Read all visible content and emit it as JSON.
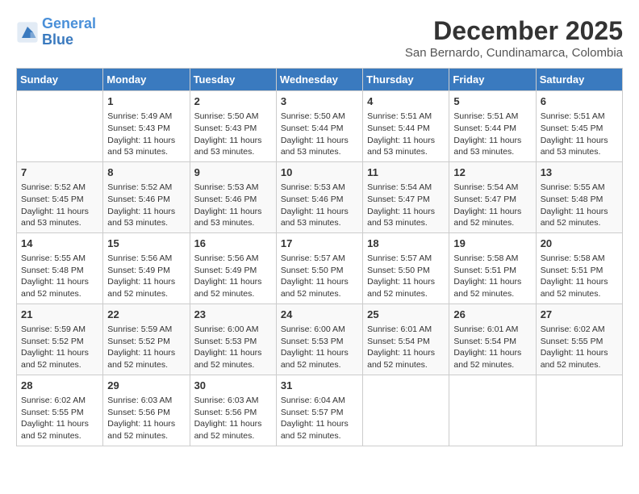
{
  "header": {
    "logo_line1": "General",
    "logo_line2": "Blue",
    "title": "December 2025",
    "subtitle": "San Bernardo, Cundinamarca, Colombia"
  },
  "days_of_week": [
    "Sunday",
    "Monday",
    "Tuesday",
    "Wednesday",
    "Thursday",
    "Friday",
    "Saturday"
  ],
  "weeks": [
    [
      {
        "day": "",
        "info": ""
      },
      {
        "day": "1",
        "info": "Sunrise: 5:49 AM\nSunset: 5:43 PM\nDaylight: 11 hours\nand 53 minutes."
      },
      {
        "day": "2",
        "info": "Sunrise: 5:50 AM\nSunset: 5:43 PM\nDaylight: 11 hours\nand 53 minutes."
      },
      {
        "day": "3",
        "info": "Sunrise: 5:50 AM\nSunset: 5:44 PM\nDaylight: 11 hours\nand 53 minutes."
      },
      {
        "day": "4",
        "info": "Sunrise: 5:51 AM\nSunset: 5:44 PM\nDaylight: 11 hours\nand 53 minutes."
      },
      {
        "day": "5",
        "info": "Sunrise: 5:51 AM\nSunset: 5:44 PM\nDaylight: 11 hours\nand 53 minutes."
      },
      {
        "day": "6",
        "info": "Sunrise: 5:51 AM\nSunset: 5:45 PM\nDaylight: 11 hours\nand 53 minutes."
      }
    ],
    [
      {
        "day": "7",
        "info": "Sunrise: 5:52 AM\nSunset: 5:45 PM\nDaylight: 11 hours\nand 53 minutes."
      },
      {
        "day": "8",
        "info": "Sunrise: 5:52 AM\nSunset: 5:46 PM\nDaylight: 11 hours\nand 53 minutes."
      },
      {
        "day": "9",
        "info": "Sunrise: 5:53 AM\nSunset: 5:46 PM\nDaylight: 11 hours\nand 53 minutes."
      },
      {
        "day": "10",
        "info": "Sunrise: 5:53 AM\nSunset: 5:46 PM\nDaylight: 11 hours\nand 53 minutes."
      },
      {
        "day": "11",
        "info": "Sunrise: 5:54 AM\nSunset: 5:47 PM\nDaylight: 11 hours\nand 53 minutes."
      },
      {
        "day": "12",
        "info": "Sunrise: 5:54 AM\nSunset: 5:47 PM\nDaylight: 11 hours\nand 52 minutes."
      },
      {
        "day": "13",
        "info": "Sunrise: 5:55 AM\nSunset: 5:48 PM\nDaylight: 11 hours\nand 52 minutes."
      }
    ],
    [
      {
        "day": "14",
        "info": "Sunrise: 5:55 AM\nSunset: 5:48 PM\nDaylight: 11 hours\nand 52 minutes."
      },
      {
        "day": "15",
        "info": "Sunrise: 5:56 AM\nSunset: 5:49 PM\nDaylight: 11 hours\nand 52 minutes."
      },
      {
        "day": "16",
        "info": "Sunrise: 5:56 AM\nSunset: 5:49 PM\nDaylight: 11 hours\nand 52 minutes."
      },
      {
        "day": "17",
        "info": "Sunrise: 5:57 AM\nSunset: 5:50 PM\nDaylight: 11 hours\nand 52 minutes."
      },
      {
        "day": "18",
        "info": "Sunrise: 5:57 AM\nSunset: 5:50 PM\nDaylight: 11 hours\nand 52 minutes."
      },
      {
        "day": "19",
        "info": "Sunrise: 5:58 AM\nSunset: 5:51 PM\nDaylight: 11 hours\nand 52 minutes."
      },
      {
        "day": "20",
        "info": "Sunrise: 5:58 AM\nSunset: 5:51 PM\nDaylight: 11 hours\nand 52 minutes."
      }
    ],
    [
      {
        "day": "21",
        "info": "Sunrise: 5:59 AM\nSunset: 5:52 PM\nDaylight: 11 hours\nand 52 minutes."
      },
      {
        "day": "22",
        "info": "Sunrise: 5:59 AM\nSunset: 5:52 PM\nDaylight: 11 hours\nand 52 minutes."
      },
      {
        "day": "23",
        "info": "Sunrise: 6:00 AM\nSunset: 5:53 PM\nDaylight: 11 hours\nand 52 minutes."
      },
      {
        "day": "24",
        "info": "Sunrise: 6:00 AM\nSunset: 5:53 PM\nDaylight: 11 hours\nand 52 minutes."
      },
      {
        "day": "25",
        "info": "Sunrise: 6:01 AM\nSunset: 5:54 PM\nDaylight: 11 hours\nand 52 minutes."
      },
      {
        "day": "26",
        "info": "Sunrise: 6:01 AM\nSunset: 5:54 PM\nDaylight: 11 hours\nand 52 minutes."
      },
      {
        "day": "27",
        "info": "Sunrise: 6:02 AM\nSunset: 5:55 PM\nDaylight: 11 hours\nand 52 minutes."
      }
    ],
    [
      {
        "day": "28",
        "info": "Sunrise: 6:02 AM\nSunset: 5:55 PM\nDaylight: 11 hours\nand 52 minutes."
      },
      {
        "day": "29",
        "info": "Sunrise: 6:03 AM\nSunset: 5:56 PM\nDaylight: 11 hours\nand 52 minutes."
      },
      {
        "day": "30",
        "info": "Sunrise: 6:03 AM\nSunset: 5:56 PM\nDaylight: 11 hours\nand 52 minutes."
      },
      {
        "day": "31",
        "info": "Sunrise: 6:04 AM\nSunset: 5:57 PM\nDaylight: 11 hours\nand 52 minutes."
      },
      {
        "day": "",
        "info": ""
      },
      {
        "day": "",
        "info": ""
      },
      {
        "day": "",
        "info": ""
      }
    ]
  ]
}
